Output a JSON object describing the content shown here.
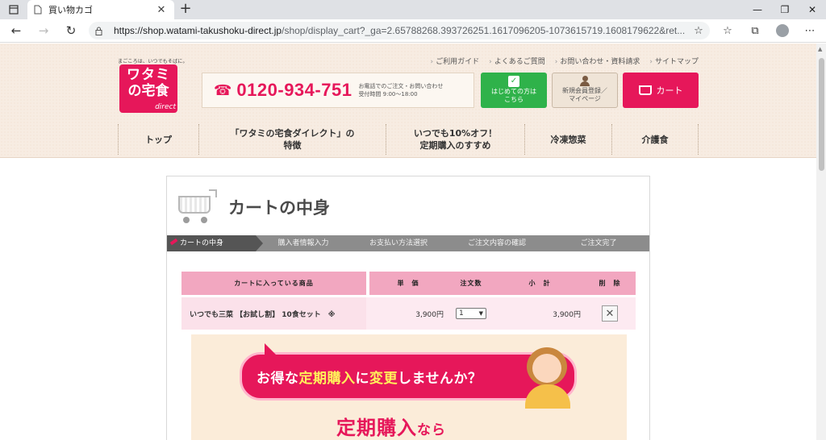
{
  "browser": {
    "tab_title": "買い物カゴ",
    "url_host": "https://shop.watami-takushoku-direct.jp",
    "url_path": "/shop/display_cart?_ga=2.65788268.393726251.1617096205-1073615719.1608179622&ret..."
  },
  "header": {
    "tagline": "まごころは、いつでもそばに。",
    "logo_line1": "ワタミ",
    "logo_line2": "の宅食",
    "logo_sub": "direct",
    "util_nav": [
      "ご利用ガイド",
      "よくあるご質問",
      "お問い合わせ・資料請求",
      "サイトマップ"
    ],
    "phone": "0120-934-751",
    "phone_note_1": "お電話でのご注文・お問い合わせ",
    "phone_note_2": "受付時間 9:00〜18:00",
    "first_time_1": "はじめての方は",
    "first_time_2": "こちら",
    "member_1": "新規会員登録／",
    "member_2": "マイページ",
    "cart_label": "カート",
    "gnav": [
      {
        "line1": "トップ",
        "line2": ""
      },
      {
        "line1": "「ワタミの宅食ダイレクト」の",
        "line2": "特徴"
      },
      {
        "line1": "いつでも10%オフ！",
        "line2": "定期購入のすすめ"
      },
      {
        "line1": "冷凍惣菜",
        "line2": ""
      },
      {
        "line1": "介護食",
        "line2": ""
      }
    ]
  },
  "cart": {
    "title": "カートの中身",
    "steps": [
      "カートの中身",
      "購入者情報入力",
      "お支払い方法選択",
      "ご注文内容の確認",
      "ご注文完了"
    ],
    "columns": {
      "item": "カートに入っている商品",
      "price": "単　価",
      "qty": "注文数",
      "subtotal": "小　計",
      "delete": "削　除"
    },
    "rows": [
      {
        "name": "いつでも三菜 【お試し割】 10食セット　※",
        "price": "3,900円",
        "qty": "1",
        "subtotal": "3,900円"
      }
    ],
    "banner": {
      "pre": "お得な",
      "em1": "定期購入",
      "mid": "に",
      "em2": "変更",
      "post": "しませんか？",
      "sub_big": "定期購入",
      "sub_small": "なら"
    }
  },
  "colors": {
    "brand": "#e6175a",
    "accent_green": "#2fb24a",
    "header_bg": "#f7ece2"
  }
}
